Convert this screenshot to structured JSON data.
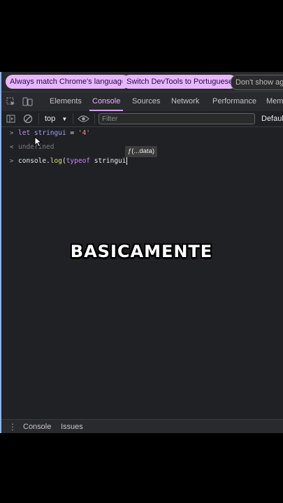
{
  "infobar": {
    "buttons": [
      "Always match Chrome's language",
      "Switch DevTools to Portuguese",
      "Don't show aga"
    ]
  },
  "tabs": [
    "Elements",
    "Console",
    "Sources",
    "Network",
    "Performance",
    "Mem"
  ],
  "toolbar": {
    "context": "top",
    "filter_placeholder": "Filter",
    "levels": "Defaul"
  },
  "console": {
    "lines": [
      {
        "keyword": "let",
        "var": "stringui",
        "op": " = ",
        "value": "'4'"
      },
      {
        "result": "undefined"
      },
      {
        "obj": "console",
        "dot": ".",
        "method": "log",
        "paren": "(",
        "keyword": "typeof",
        "arg": " stringui"
      }
    ],
    "tooltip": "ƒ(...data)"
  },
  "overlay_caption": "BASICAMENTE",
  "drawer": {
    "tabs": [
      "Console",
      "Issues"
    ]
  },
  "colors": {
    "accent": "#e8b6ff",
    "background": "#202124"
  }
}
